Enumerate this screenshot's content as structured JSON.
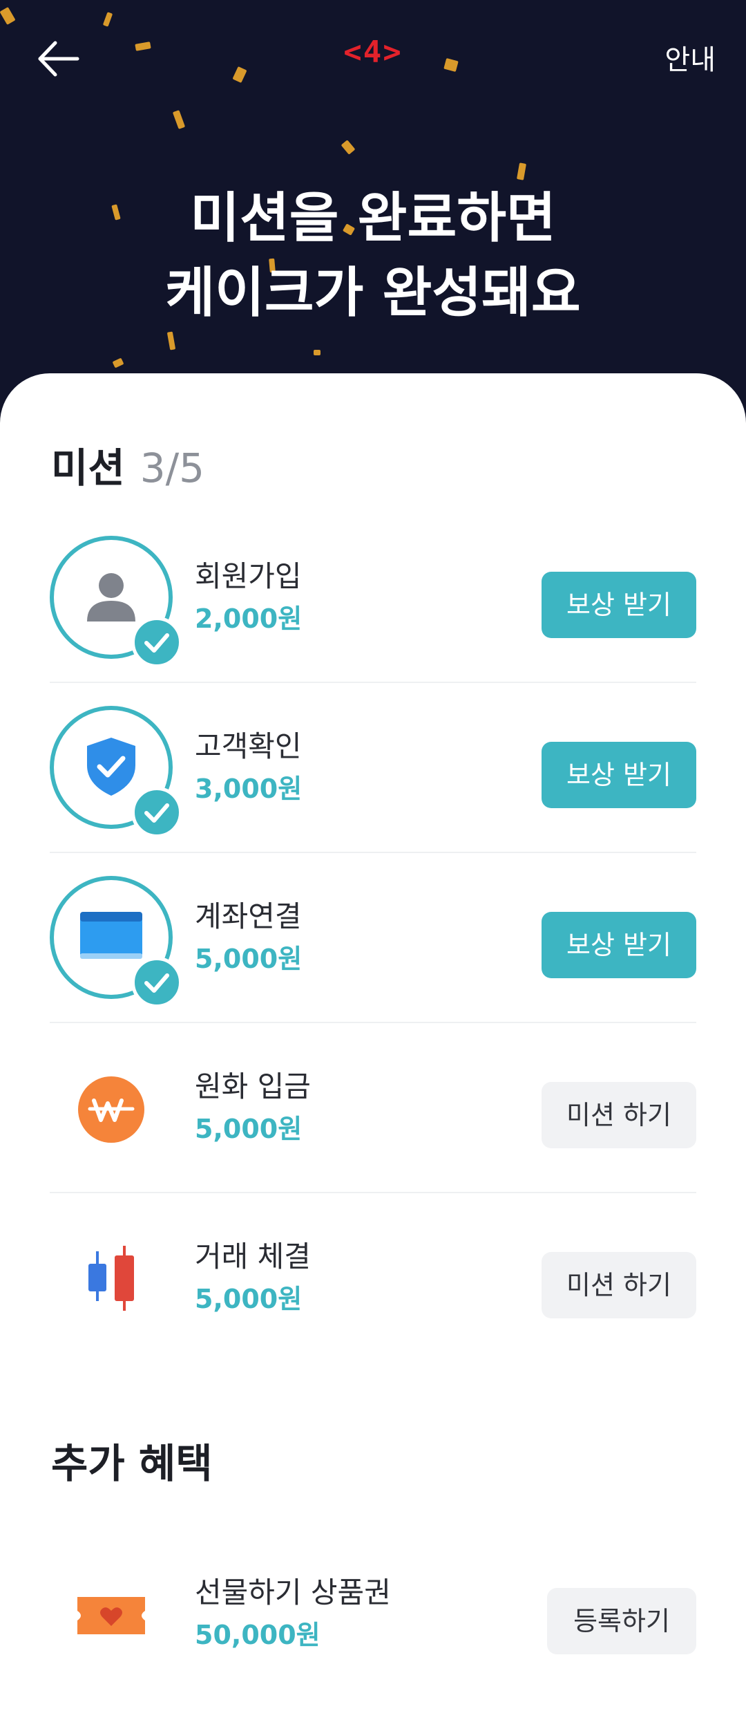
{
  "header": {
    "step_label": "<4>",
    "guide_label": "안내",
    "title_line1": "미션을 완료하면",
    "title_line2": "케이크가 완성돼요"
  },
  "missions": {
    "title": "미션",
    "count": "3/5",
    "items": [
      {
        "title": "회원가입",
        "reward": "2,000원",
        "button": "보상 받기",
        "completed": true,
        "icon": "user-icon"
      },
      {
        "title": "고객확인",
        "reward": "3,000원",
        "button": "보상 받기",
        "completed": true,
        "icon": "shield-check-icon"
      },
      {
        "title": "계좌연결",
        "reward": "5,000원",
        "button": "보상 받기",
        "completed": true,
        "icon": "bank-card-icon"
      },
      {
        "title": "원화 입금",
        "reward": "5,000원",
        "button": "미션 하기",
        "completed": false,
        "icon": "won-coin-icon"
      },
      {
        "title": "거래 체결",
        "reward": "5,000원",
        "button": "미션 하기",
        "completed": false,
        "icon": "candlestick-chart-icon"
      }
    ]
  },
  "extra": {
    "title": "추가 혜택",
    "items": [
      {
        "title": "선물하기 상품권",
        "reward": "50,000원",
        "button": "등록하기",
        "icon": "gift-ticket-icon"
      }
    ]
  },
  "colors": {
    "hero_bg": "#11142a",
    "accent": "#3db5c2",
    "step_label": "#e3222b",
    "confetti": "#d99a2b"
  }
}
